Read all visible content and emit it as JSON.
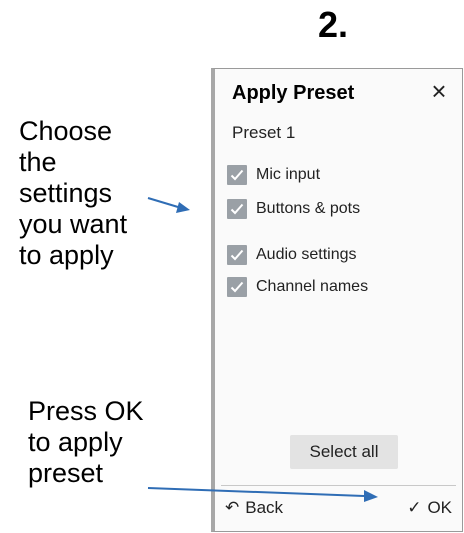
{
  "step_number": "2.",
  "annotations": {
    "settings_lines": [
      "Choose",
      "the",
      "settings",
      "you want",
      "to apply"
    ],
    "ok_lines": [
      "Press OK",
      "to apply",
      "preset"
    ]
  },
  "dialog": {
    "title": "Apply Preset",
    "close_icon": "close-icon",
    "preset_name": "Preset 1",
    "options": [
      {
        "label": "Mic input",
        "checked": true
      },
      {
        "label": "Buttons & pots",
        "checked": true
      },
      {
        "label": "Audio settings",
        "checked": true
      },
      {
        "label": "Channel names",
        "checked": true
      }
    ],
    "select_all_label": "Select all",
    "back_label": "Back",
    "ok_label": "OK"
  },
  "colors": {
    "arrow": "#2f6db5",
    "checkbox": "#9aa0a6"
  }
}
